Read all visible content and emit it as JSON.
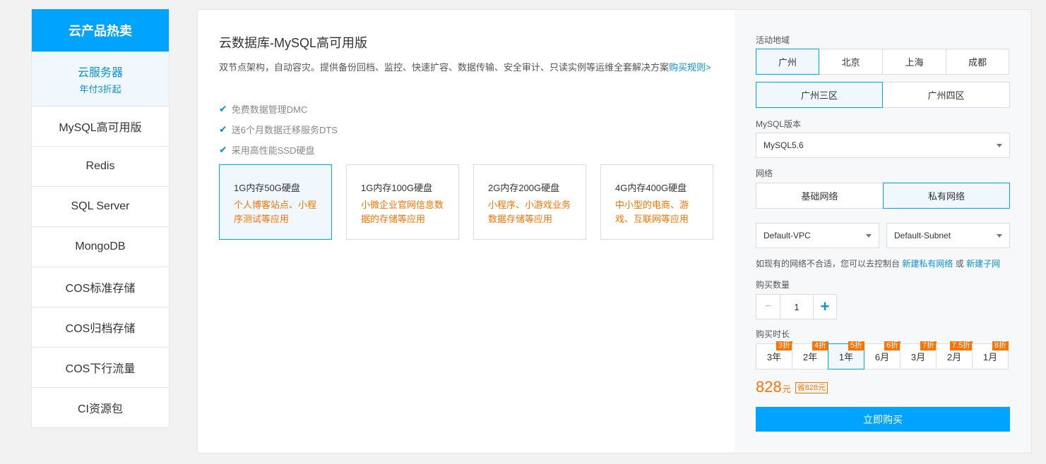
{
  "sidebar": {
    "header": "云产品热卖",
    "active": {
      "label": "云服务器",
      "sub": "年付3折起"
    },
    "items": [
      "MySQL高可用版",
      "Redis",
      "SQL Server",
      "MongoDB",
      "COS标准存储",
      "COS归档存储",
      "COS下行流量",
      "CI资源包"
    ]
  },
  "product": {
    "title": "云数据库-MySQL高可用版",
    "desc": "双节点架构，自动容灾。提供备份回档、监控、快速扩容、数据传输、安全审计、只读实例等运维全套解决方案",
    "desc_link": "购买规则>",
    "features": [
      "免费数据管理DMC",
      "送6个月数据迁移服务DTS",
      "采用高性能SSD硬盘"
    ],
    "check_icon": "✔",
    "specs": [
      {
        "title": "1G内存50G硬盘",
        "desc": "个人博客站点、小程序测试等应用"
      },
      {
        "title": "1G内存100G硬盘",
        "desc": "小微企业官网信息数据的存储等应用"
      },
      {
        "title": "2G内存200G硬盘",
        "desc": "小程序、小游戏业务数据存储等应用"
      },
      {
        "title": "4G内存400G硬盘",
        "desc": "中小型的电商、游戏、互联网等应用"
      }
    ]
  },
  "form": {
    "region_label": "活动地域",
    "regions": [
      "广州",
      "北京",
      "上海",
      "成都"
    ],
    "zones": [
      "广州三区",
      "广州四区"
    ],
    "version_label": "MySQL版本",
    "version_value": "MySQL5.6",
    "network_label": "网络",
    "networks": [
      "基础网络",
      "私有网络"
    ],
    "vpc_value": "Default-VPC",
    "subnet_value": "Default-Subnet",
    "hint_text": "如现有的网络不合适，您可以去控制台",
    "hint_link1": "新建私有网络",
    "hint_or": "或",
    "hint_link2": "新建子网",
    "quantity_label": "购买数量",
    "quantity_minus": "−",
    "quantity_value": "1",
    "quantity_plus": "+",
    "duration_label": "购买时长",
    "durations": [
      {
        "label": "3年",
        "tag": "3折"
      },
      {
        "label": "2年",
        "tag": "4折"
      },
      {
        "label": "1年",
        "tag": "5折"
      },
      {
        "label": "6月",
        "tag": "6折"
      },
      {
        "label": "3月",
        "tag": "7折"
      },
      {
        "label": "2月",
        "tag": "7.5折"
      },
      {
        "label": "1月",
        "tag": "8折"
      }
    ],
    "price_value": "828",
    "price_unit": "元",
    "price_save": "省828元",
    "buy_label": "立即购买"
  },
  "colors": {
    "accent": "#00a4ff",
    "orange": "#ff7200",
    "link": "#0b8fd8"
  }
}
